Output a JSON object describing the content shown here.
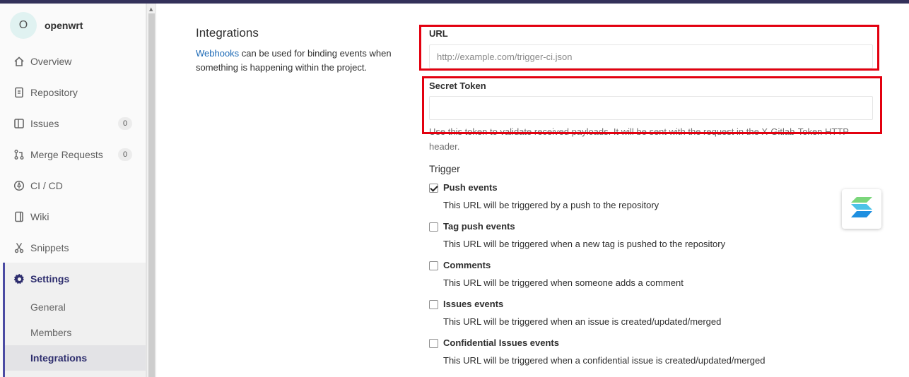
{
  "project": {
    "avatar_letter": "O",
    "name": "openwrt"
  },
  "sidebar": {
    "items": [
      {
        "label": "Overview",
        "icon": "home-icon"
      },
      {
        "label": "Repository",
        "icon": "document-icon"
      },
      {
        "label": "Issues",
        "icon": "issues-icon",
        "badge": "0"
      },
      {
        "label": "Merge Requests",
        "icon": "merge-request-icon",
        "badge": "0"
      },
      {
        "label": "CI / CD",
        "icon": "rocket-icon"
      },
      {
        "label": "Wiki",
        "icon": "book-icon"
      },
      {
        "label": "Snippets",
        "icon": "scissors-icon"
      },
      {
        "label": "Settings",
        "icon": "gear-icon"
      }
    ],
    "settings_sub": [
      "General",
      "Members",
      "Integrations"
    ]
  },
  "main": {
    "title": "Integrations",
    "desc_link": "Webhooks",
    "desc_text": " can be used for binding events when something is happening within the project.",
    "url_label": "URL",
    "url_placeholder": "http://example.com/trigger-ci.json",
    "url_value": "",
    "token_label": "Secret Token",
    "token_value": "",
    "token_help": "Use this token to validate received payloads. It will be sent with the request in the X-Gitlab-Token HTTP header.",
    "trigger_label": "Trigger",
    "triggers": [
      {
        "title": "Push events",
        "desc": "This URL will be triggered by a push to the repository",
        "checked": true
      },
      {
        "title": "Tag push events",
        "desc": "This URL will be triggered when a new tag is pushed to the repository",
        "checked": false
      },
      {
        "title": "Comments",
        "desc": "This URL will be triggered when someone adds a comment",
        "checked": false
      },
      {
        "title": "Issues events",
        "desc": "This URL will be triggered when an issue is created/updated/merged",
        "checked": false
      },
      {
        "title": "Confidential Issues events",
        "desc": "This URL will be triggered when a confidential issue is created/updated/merged",
        "checked": false
      }
    ]
  },
  "colors": {
    "highlight_box": "#e3000f",
    "link": "#1b69b6",
    "topbar": "#33315a",
    "settings_accent": "#4b4ba3"
  }
}
